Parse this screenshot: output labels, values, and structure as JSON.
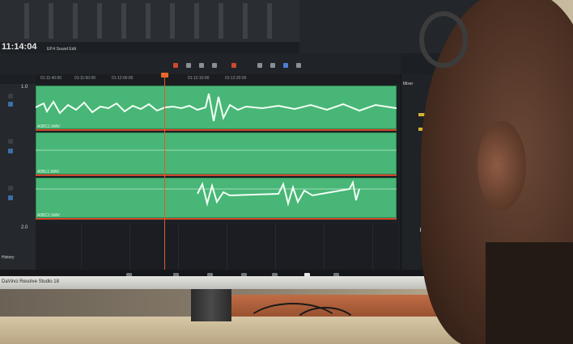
{
  "app": {
    "clip_title": "EP.4 Sound Edit",
    "timecode": "11:14:04",
    "brand": "DaVinci Resolve Studio 18"
  },
  "ruler": {
    "labels": [
      "01:11:40:00",
      "01:11:50:00",
      "01:12:00:00",
      "01:12:10:00",
      "01:12:20:00"
    ]
  },
  "tracks": [
    {
      "num": "1.0",
      "clip": "A0BC1.WAV"
    },
    {
      "num": "",
      "clip": "A0BL1.WAV"
    },
    {
      "num": "",
      "clip": "A0BC1.WAV"
    }
  ],
  "lower_level": "2.0",
  "history_label": "History",
  "mixer": {
    "title": "Mixer"
  },
  "pages": [
    {
      "label": "Media"
    },
    {
      "label": "Cut"
    },
    {
      "label": "Edit"
    },
    {
      "label": "Fusion"
    },
    {
      "label": "Color"
    },
    {
      "label": "Fairlight"
    },
    {
      "label": "Deliver"
    }
  ],
  "colors": {
    "clip_green": "#48b676",
    "playhead": "#e05a2a",
    "clip_edge": "#d0482c"
  }
}
